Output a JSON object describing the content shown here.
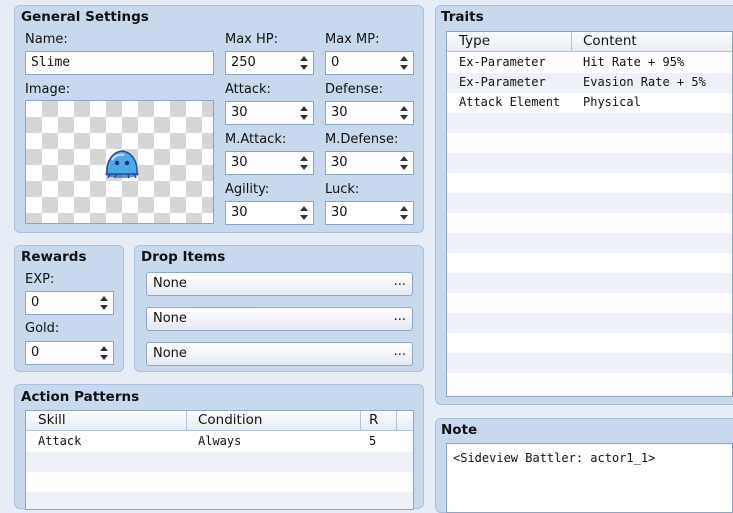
{
  "general": {
    "title": "General Settings",
    "name_label": "Name:",
    "name_value": "Slime",
    "image_label": "Image:",
    "maxhp_label": "Max HP:",
    "maxhp_value": "250",
    "maxmp_label": "Max MP:",
    "maxmp_value": "0",
    "attack_label": "Attack:",
    "attack_value": "30",
    "defense_label": "Defense:",
    "defense_value": "30",
    "mattack_label": "M.Attack:",
    "mattack_value": "30",
    "mdefense_label": "M.Defense:",
    "mdefense_value": "30",
    "agility_label": "Agility:",
    "agility_value": "30",
    "luck_label": "Luck:",
    "luck_value": "30"
  },
  "rewards": {
    "title": "Rewards",
    "exp_label": "EXP:",
    "exp_value": "0",
    "gold_label": "Gold:",
    "gold_value": "0"
  },
  "drops": {
    "title": "Drop Items",
    "items": [
      "None",
      "None",
      "None"
    ],
    "button_glyph": "..."
  },
  "actions": {
    "title": "Action Patterns",
    "columns": [
      "Skill",
      "Condition",
      "R"
    ],
    "rows": [
      {
        "skill": "Attack",
        "condition": "Always",
        "r": "5"
      }
    ]
  },
  "traits": {
    "title": "Traits",
    "columns": [
      "Type",
      "Content"
    ],
    "rows": [
      {
        "type": "Ex-Parameter",
        "content": "Hit Rate + 95%"
      },
      {
        "type": "Ex-Parameter",
        "content": "Evasion Rate + 5%"
      },
      {
        "type": "Attack Element",
        "content": "Physical"
      }
    ]
  },
  "note": {
    "title": "Note",
    "text": "<Sideview Battler: actor1_1>"
  }
}
